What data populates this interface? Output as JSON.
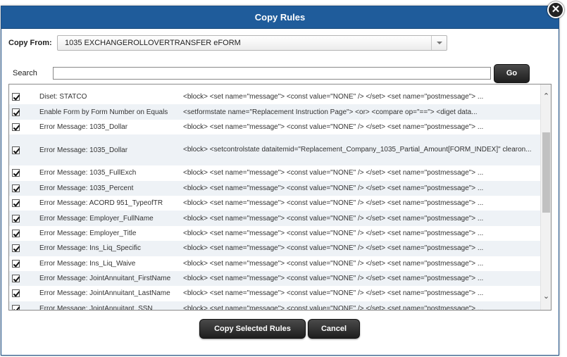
{
  "dialog": {
    "title": "Copy Rules",
    "close_glyph": "✕"
  },
  "copy_from": {
    "label": "Copy From:",
    "selected": "1035 EXCHANGEROLLOVERTRANSFER eFORM"
  },
  "search": {
    "label": "Search",
    "value": "",
    "go_label": "Go"
  },
  "rules": [
    {
      "checked": true,
      "name": "Diset: STATCO",
      "rule": "<block> <set name=\"message\"> <const value=\"NONE\" /> </set> <set name=\"postmessage\"> ..."
    },
    {
      "checked": true,
      "name": "Enable Form by Form Number on Equals",
      "rule": "<setformstate name=\"Replacement Instruction Page\"> <or> <compare op=\"==\"> <diget data..."
    },
    {
      "checked": true,
      "name": "Error Message: 1035_Dollar",
      "rule": "<block> <set name=\"message\"> <const value=\"NONE\" /> </set> <set name=\"postmessage\"> ..."
    },
    {
      "checked": true,
      "name": "Error Message: 1035_Dollar",
      "rule": "<block> <setcontrolstate dataitemid=\"Replacement_Company_1035_Partial_Amount[FORM_INDEX]\" clearon...",
      "tall": true
    },
    {
      "checked": true,
      "name": "Error Message: 1035_FullExch",
      "rule": "<block> <set name=\"message\"> <const value=\"NONE\" /> </set> <set name=\"postmessage\"> ..."
    },
    {
      "checked": true,
      "name": "Error Message: 1035_Percent",
      "rule": "<block> <set name=\"message\"> <const value=\"NONE\" /> </set> <set name=\"postmessage\"> ..."
    },
    {
      "checked": true,
      "name": "Error Message: ACORD 951_TypeofTR",
      "rule": "<block> <set name=\"message\"> <const value=\"NONE\" /> </set> <set name=\"postmessage\"> ..."
    },
    {
      "checked": true,
      "name": "Error Message: Employer_FullName",
      "rule": "<block> <set name=\"message\"> <const value=\"NONE\" /> </set> <set name=\"postmessage\"> ..."
    },
    {
      "checked": true,
      "name": "Error Message: Employer_Title",
      "rule": "<block> <set name=\"message\"> <const value=\"NONE\" /> </set> <set name=\"postmessage\"> ..."
    },
    {
      "checked": true,
      "name": "Error Message: Ins_Liq_Specific",
      "rule": "<block> <set name=\"message\"> <const value=\"NONE\" /> </set> <set name=\"postmessage\"> ..."
    },
    {
      "checked": true,
      "name": "Error Message: Ins_Liq_Waive",
      "rule": "<block> <set name=\"message\"> <const value=\"NONE\" /> </set> <set name=\"postmessage\"> ..."
    },
    {
      "checked": true,
      "name": "Error Message: JointAnnuitant_FirstName",
      "rule": "<block> <set name=\"message\"> <const value=\"NONE\" /> </set> <set name=\"postmessage\"> ..."
    },
    {
      "checked": true,
      "name": "Error Message: JointAnnuitant_LastName",
      "rule": "<block> <set name=\"message\"> <const value=\"NONE\" /> </set> <set name=\"postmessage\"> ..."
    },
    {
      "checked": true,
      "name": "Error Message: JointAnnuitant_SSN",
      "rule": "<block> <set name=\"message\"> <const value=\"NONE\" /> </set> <set name=\"postmessage\"> ..."
    }
  ],
  "footer": {
    "copy_label": "Copy Selected Rules",
    "cancel_label": "Cancel"
  },
  "colors": {
    "titlebar": "#1f5c9b",
    "button": "#2b2b2b"
  },
  "icons": {
    "close": "close-icon",
    "dropdown": "chevron-down-icon",
    "scroll_up": "chevron-up-icon",
    "scroll_down": "chevron-down-icon"
  }
}
